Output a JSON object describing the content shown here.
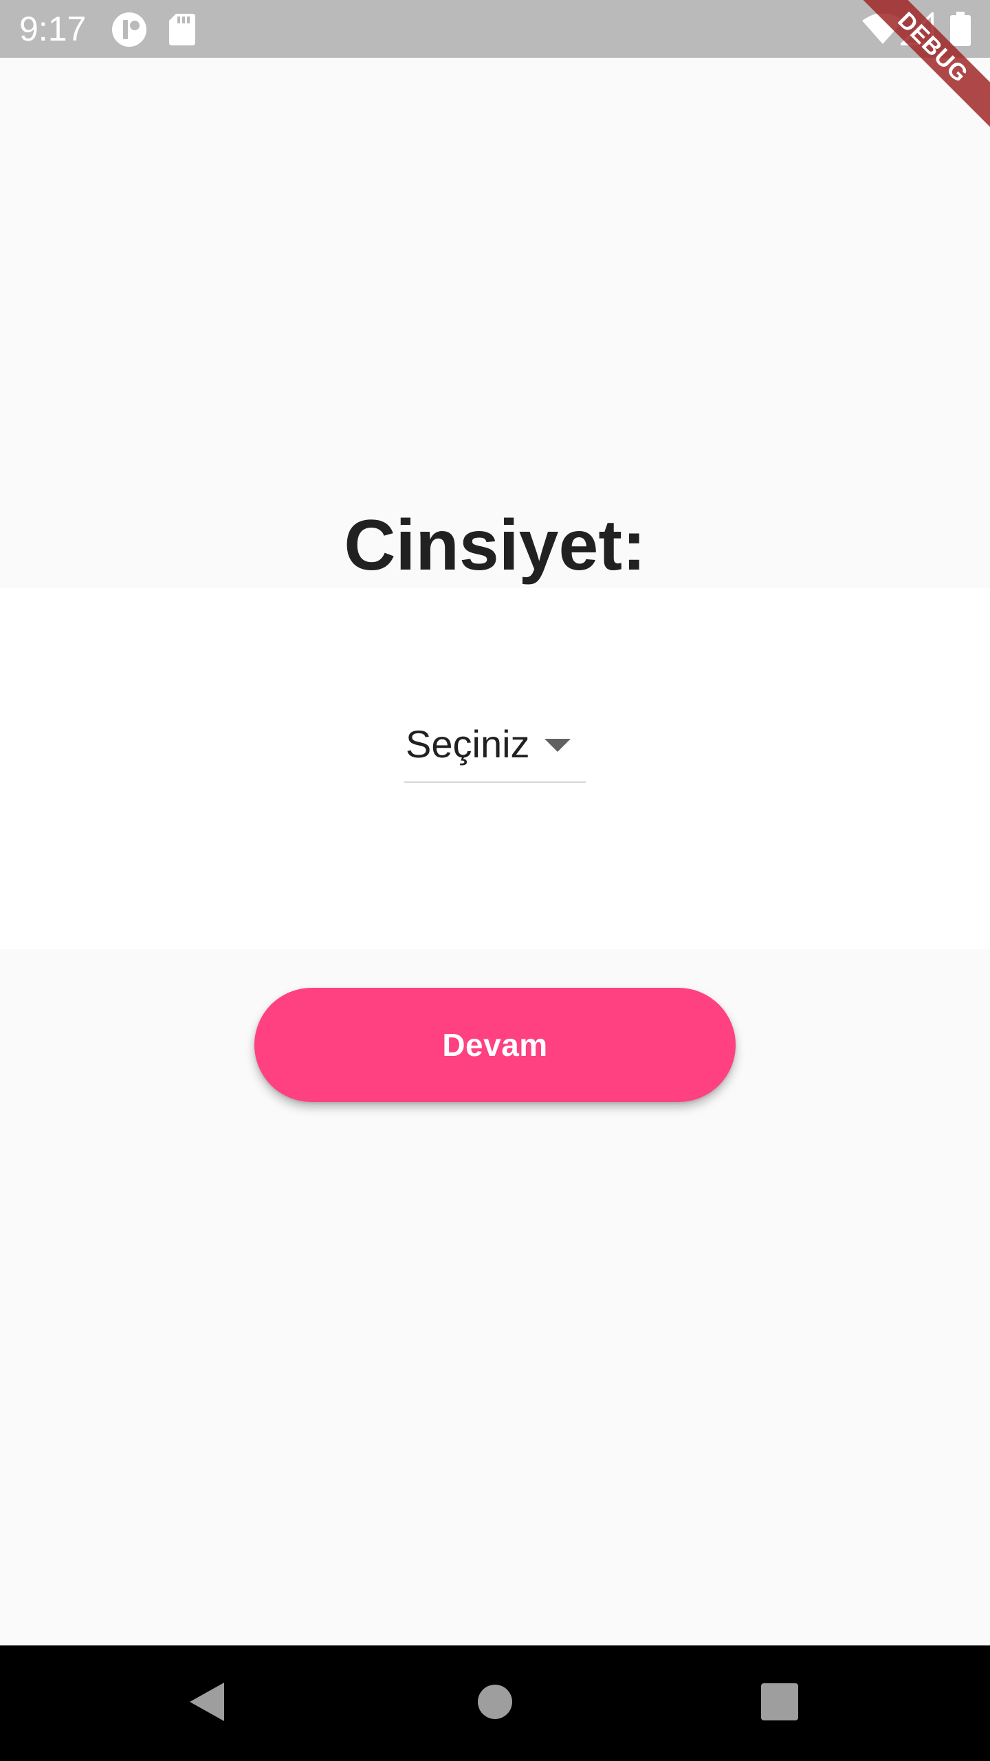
{
  "status_bar": {
    "time": "9:17",
    "icons": [
      "notification-circle-icon",
      "sd-card-icon",
      "wifi-icon",
      "cell-signal-icon",
      "battery-icon"
    ]
  },
  "debug_banner": "DEBUG",
  "main": {
    "title": "Cinsiyet:",
    "dropdown": {
      "selected": "Seçiniz"
    },
    "continue_label": "Devam"
  },
  "nav_bar": {
    "icons": [
      "back-icon",
      "home-icon",
      "recents-icon"
    ]
  },
  "colors": {
    "accent": "#ff4081",
    "status_bar": "#bababa",
    "background": "#fafafa",
    "debug_banner": "#a02828"
  }
}
